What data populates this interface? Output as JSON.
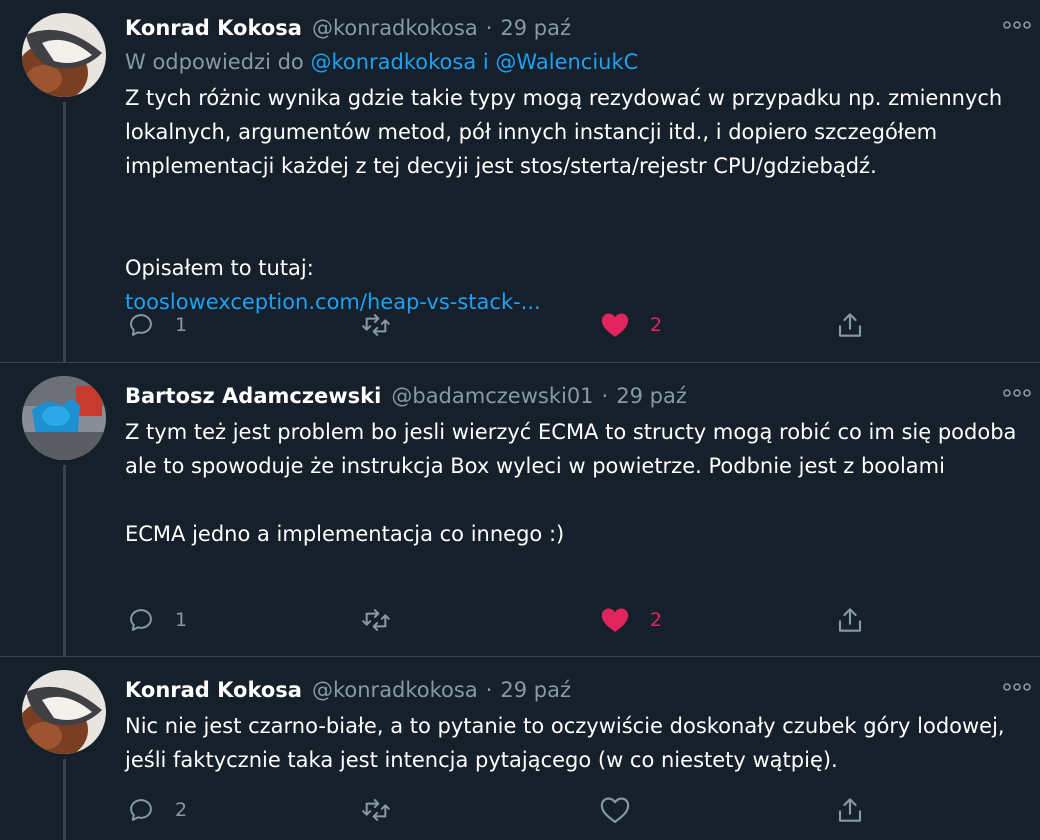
{
  "tweets": [
    {
      "name": "Konrad Kokosa",
      "handle": "@konradkokosa",
      "date": "29 paź",
      "reply_prefix": "W odpowiedzi do",
      "reply_user1": "@konradkokosa",
      "reply_and": "i",
      "reply_user2": "@WalenciukC",
      "text": "Z tych różnic wynika gdzie takie typy mogą rezydować w przypadku np. zmiennych lokalnych, argumentów metod, pół innych instancji itd., i dopiero szczegółem implementacji każdej z tej decyji jest stos/sterta/rejestr CPU/gdziebądź.",
      "text2_prefix": "Opisałem to tutaj:",
      "text2_link": "tooslowexception.com/heap-vs-stack-...",
      "reply_count": "1",
      "like_count": "2",
      "liked": true
    },
    {
      "name": "Bartosz Adamczewski",
      "handle": "@badamczewski01",
      "date": "29 paź",
      "text": "Z tym też jest problem bo jesli wierzyć ECMA to structy mogą robić co im się podoba ale to spowoduje że instrukcja Box wyleci w powietrze. Podbnie jest z boolami\n\nECMA jedno a implementacja co innego :)",
      "reply_count": "1",
      "like_count": "2",
      "liked": true
    },
    {
      "name": "Konrad Kokosa",
      "handle": "@konradkokosa",
      "date": "29 paź",
      "text": "Nic nie jest czarno-białe, a to pytanie to oczywiście doskonały czubek góry lodowej, jeśli faktycznie taka jest intencja pytającego (w co niestety wątpię).",
      "reply_count": "2",
      "like_count": "",
      "liked": false
    }
  ],
  "separator": "·",
  "icons": [
    "more-icon",
    "reply-icon",
    "retweet-icon",
    "like-icon",
    "share-icon"
  ],
  "colors": {
    "background": "#15202b",
    "muted": "#8899a6",
    "link": "#1da1f2",
    "like": "#e0245e",
    "border": "#38444d"
  }
}
